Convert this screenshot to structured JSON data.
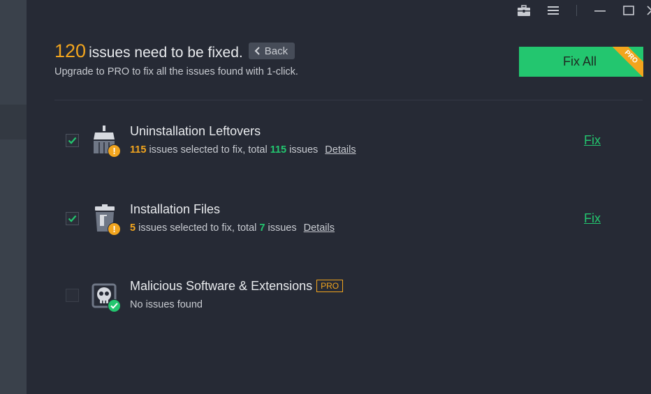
{
  "window_controls": {
    "icons": [
      "toolbox-icon",
      "menu-icon",
      "minimize-icon",
      "maximize-icon",
      "close-icon"
    ]
  },
  "header": {
    "issue_count": "120",
    "headline_text": "issues need to be fixed.",
    "back_label": "Back",
    "subline": "Upgrade to PRO to fix all the issues found with 1-click."
  },
  "fix_all": {
    "label": "Fix All",
    "ribbon": "PRO"
  },
  "rows": [
    {
      "title": "Uninstallation Leftovers",
      "checked": true,
      "selected_count": "115",
      "desc_middle": "issues selected to fix, total",
      "total_count": "115",
      "desc_end": "issues",
      "details_label": "Details",
      "fix_label": "Fix",
      "icon": "broom-icon",
      "status_icon": "warning-icon"
    },
    {
      "title": "Installation Files",
      "checked": true,
      "selected_count": "5",
      "desc_middle": "issues selected to fix, total",
      "total_count": "7",
      "desc_end": "issues",
      "details_label": "Details",
      "fix_label": "Fix",
      "icon": "trash-bin-icon",
      "status_icon": "warning-icon"
    },
    {
      "title": "Malicious Software & Extensions",
      "checked": false,
      "pro_tag": "PRO",
      "status_text": "No issues found",
      "icon": "skull-shield-icon",
      "status_icon": "check-icon"
    }
  ],
  "colors": {
    "accent_green": "#23c66f",
    "accent_orange": "#f2a51e",
    "panel_bg": "#262a35"
  }
}
